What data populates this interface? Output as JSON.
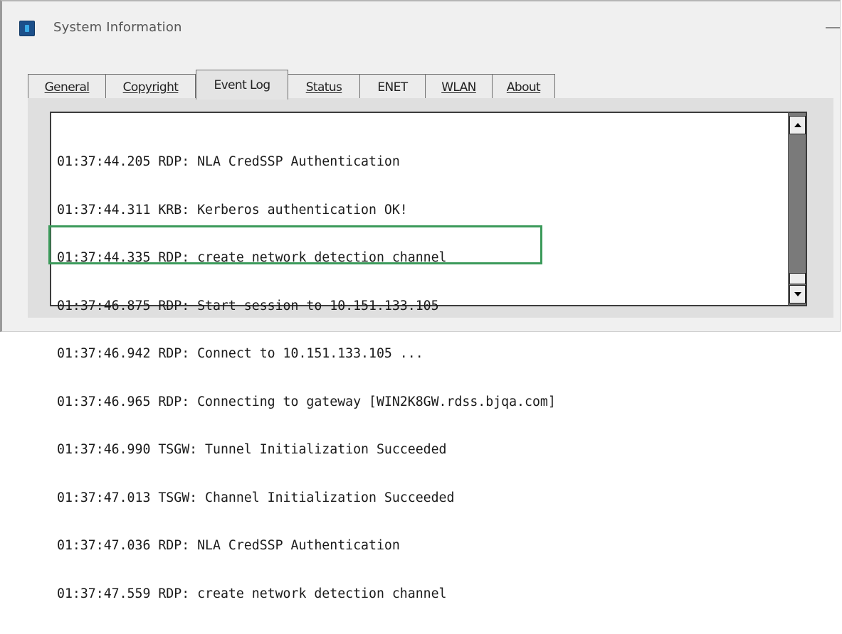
{
  "window": {
    "title": "System Information",
    "icon": "system-info-icon"
  },
  "tabs": [
    {
      "label": "General",
      "active": false
    },
    {
      "label": "Copyright",
      "active": false
    },
    {
      "label": "Event Log",
      "active": true
    },
    {
      "label": "Status",
      "active": false
    },
    {
      "label": "ENET",
      "active": false
    },
    {
      "label": "WLAN",
      "active": false
    },
    {
      "label": "About",
      "active": false
    }
  ],
  "event_log": {
    "lines": [
      "01:37:44.205 RDP: NLA CredSSP Authentication",
      "01:37:44.311 KRB: Kerberos authentication OK!",
      "01:37:44.335 RDP: create network detection channel",
      "01:37:46.875 RDP: Start session to 10.151.133.105",
      "01:37:46.942 RDP: Connect to 10.151.133.105 ...",
      "01:37:46.965 RDP: Connecting to gateway [WIN2K8GW.rdss.bjqa.com]",
      "01:37:46.990 TSGW: Tunnel Initialization Succeeded",
      "01:37:47.013 TSGW: Channel Initialization Succeeded",
      "01:37:47.036 RDP: NLA CredSSP Authentication",
      "01:37:47.559 RDP: create network detection channel"
    ],
    "highlight_color": "#3b9a5a"
  },
  "scrollbar": {
    "up_icon": "arrow-up-icon",
    "down_icon": "arrow-down-icon",
    "position": 0.95
  }
}
